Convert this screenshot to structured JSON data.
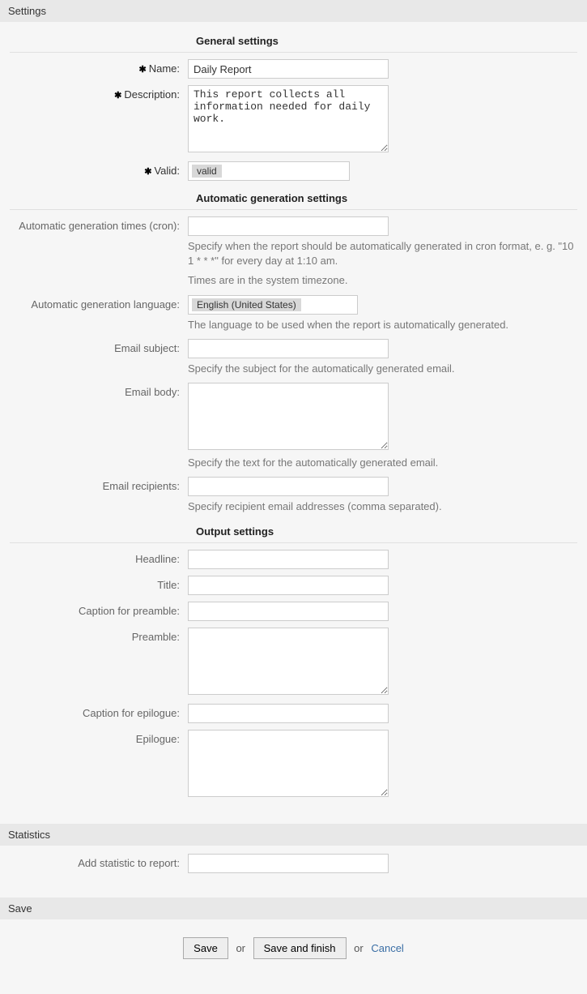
{
  "panels": {
    "settings": {
      "title": "Settings"
    },
    "statistics": {
      "title": "Statistics"
    },
    "save": {
      "title": "Save"
    }
  },
  "sections": {
    "general": {
      "heading": "General settings"
    },
    "autogen": {
      "heading": "Automatic generation settings"
    },
    "output": {
      "heading": "Output settings"
    }
  },
  "fields": {
    "name": {
      "label": "Name:",
      "value": "Daily Report"
    },
    "description": {
      "label": "Description:",
      "value": "This report collects all information needed for daily work."
    },
    "valid": {
      "label": "Valid:",
      "value": "valid"
    },
    "cron": {
      "label": "Automatic generation times (cron):",
      "value": "",
      "help1": "Specify when the report should be automatically generated in cron format, e. g. \"10 1 * * *\" for every day at 1:10 am.",
      "help2": "Times are in the system timezone."
    },
    "language": {
      "label": "Automatic generation language:",
      "value": "English (United States)",
      "help": "The language to be used when the report is automatically generated."
    },
    "email_subject": {
      "label": "Email subject:",
      "value": "",
      "help": "Specify the subject for the automatically generated email."
    },
    "email_body": {
      "label": "Email body:",
      "value": "",
      "help": "Specify the text for the automatically generated email."
    },
    "email_recipients": {
      "label": "Email recipients:",
      "value": "",
      "help": "Specify recipient email addresses (comma separated)."
    },
    "headline": {
      "label": "Headline:",
      "value": ""
    },
    "title": {
      "label": "Title:",
      "value": ""
    },
    "caption_preamble": {
      "label": "Caption for preamble:",
      "value": ""
    },
    "preamble": {
      "label": "Preamble:",
      "value": ""
    },
    "caption_epilogue": {
      "label": "Caption for epilogue:",
      "value": ""
    },
    "epilogue": {
      "label": "Epilogue:",
      "value": ""
    },
    "add_statistic": {
      "label": "Add statistic to report:",
      "value": ""
    }
  },
  "buttons": {
    "save": "Save",
    "save_and_finish": "Save and finish",
    "or": "or",
    "cancel": "Cancel"
  }
}
